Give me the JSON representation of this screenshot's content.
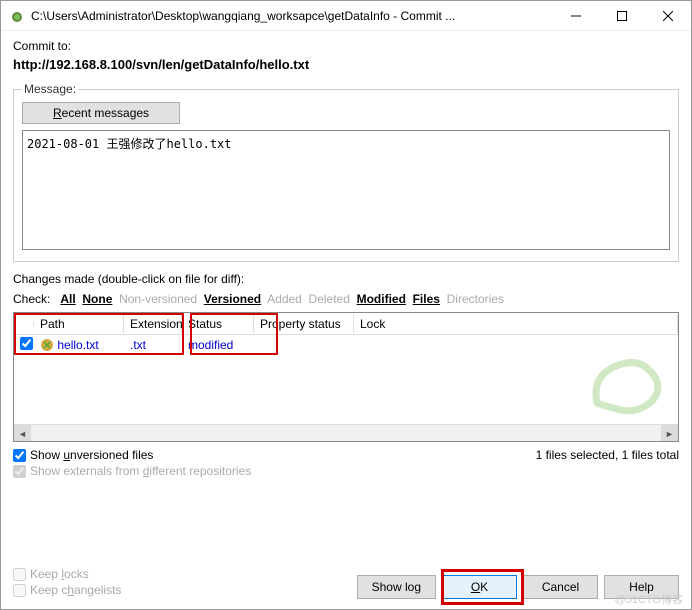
{
  "titlebar": {
    "path": "C:\\Users\\Administrator\\Desktop\\wangqiang_worksapce\\getDataInfo - Commit ..."
  },
  "commit": {
    "label": "Commit to:",
    "url": "http://192.168.8.100/svn/len/getDataInfo/hello.txt"
  },
  "message": {
    "legend": "Message:",
    "recent_btn": "Recent messages",
    "text": "2021-08-01 王强修改了hello.txt"
  },
  "changes": {
    "label": "Changes made (double-click on file for diff):",
    "check_label": "Check:",
    "all": "All",
    "none": "None",
    "nonversioned": "Non-versioned",
    "versioned": "Versioned",
    "added": "Added",
    "deleted": "Deleted",
    "modified": "Modified",
    "files": "Files",
    "directories": "Directories",
    "headers": {
      "path": "Path",
      "extension": "Extension",
      "status": "Status",
      "property_status": "Property status",
      "lock": "Lock"
    },
    "rows": [
      {
        "checked": true,
        "filename": "hello.txt",
        "extension": ".txt",
        "status": "modified",
        "property_status": "",
        "lock": ""
      }
    ],
    "show_unversioned": "Show unversioned files",
    "show_externals": "Show externals from different repositories",
    "status_text": "1 files selected, 1 files total"
  },
  "bottom": {
    "keep_locks": "Keep locks",
    "keep_changelists": "Keep changelists"
  },
  "buttons": {
    "show_log": "Show log",
    "ok": "OK",
    "cancel": "Cancel",
    "help": "Help"
  },
  "footer_watermark": "@51CTO博客"
}
